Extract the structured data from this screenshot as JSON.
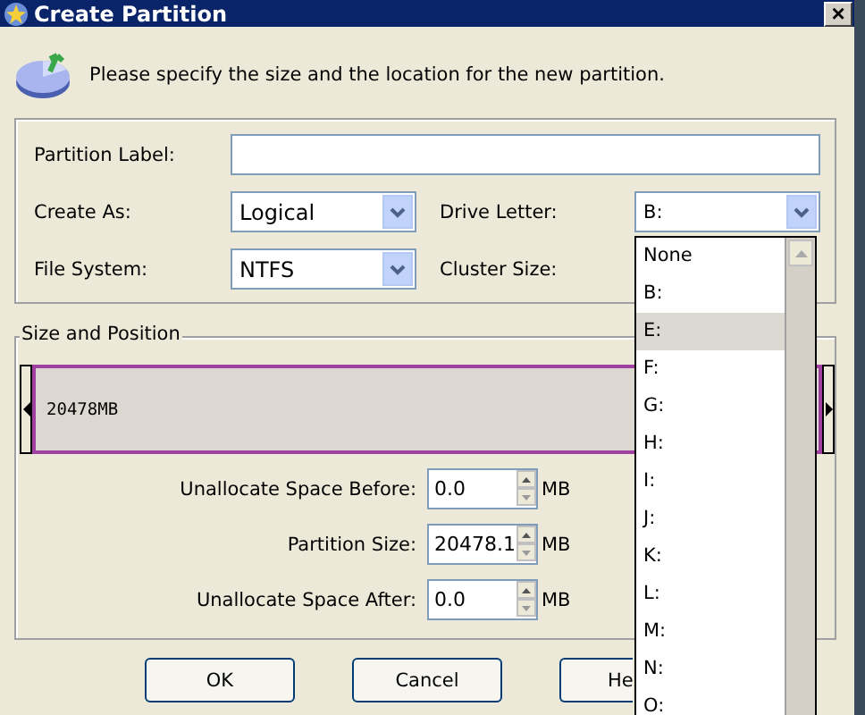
{
  "window": {
    "title": "Create Partition",
    "close": "×"
  },
  "instruction": "Please specify the size and the location for the new partition.",
  "partition_label": {
    "label": "Partition Label:"
  },
  "create_as": {
    "label": "Create As:",
    "value": "Logical"
  },
  "drive_letter": {
    "label": "Drive Letter:",
    "value": "B:"
  },
  "file_system": {
    "label": "File System:",
    "value": "NTFS"
  },
  "cluster_size": {
    "label": "Cluster Size:"
  },
  "size_position": {
    "title": "Size and Position",
    "bar_label": "20478MB"
  },
  "spinners": [
    {
      "label": "Unallocate Space Before:",
      "value": "0.0",
      "unit": "MB"
    },
    {
      "label": "Partition Size:",
      "value": "20478.1",
      "unit": "MB"
    },
    {
      "label": "Unallocate Space After:",
      "value": "0.0",
      "unit": "MB"
    }
  ],
  "buttons": [
    "OK",
    "Cancel",
    "He"
  ],
  "drive_dropdown": [
    {
      "label": "None",
      "selected": false
    },
    {
      "label": "B:",
      "selected": false
    },
    {
      "label": "E:",
      "selected": true
    },
    {
      "label": "F:",
      "selected": false
    },
    {
      "label": "G:",
      "selected": false
    },
    {
      "label": "H:",
      "selected": false
    },
    {
      "label": "I:",
      "selected": false
    },
    {
      "label": "J:",
      "selected": false
    },
    {
      "label": "K:",
      "selected": false
    },
    {
      "label": "L:",
      "selected": false
    },
    {
      "label": "M:",
      "selected": false
    },
    {
      "label": "N:",
      "selected": false
    },
    {
      "label": "O:",
      "selected": false
    }
  ]
}
